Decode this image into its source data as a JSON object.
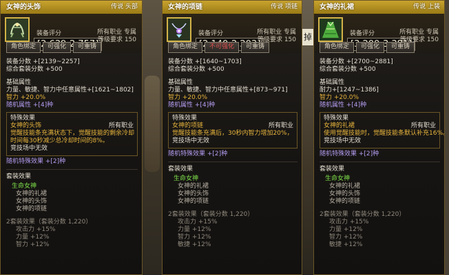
{
  "panels": [
    {
      "title": "女神的头饰",
      "tag": "传说 头部",
      "score_label": "装备评分",
      "score": "[2,639-2,757]",
      "class": "所有职业 专属",
      "level": "等级要求 150",
      "buttons": [
        "角色绑定",
        "可强化",
        "可重铸"
      ],
      "equip_score": "装备分数 +[2139~2257]",
      "set_score": "综合套装分数 +500",
      "base_title": "基础属性",
      "base_lines": [
        "力量、敏捷、智力中任意属性+[1621~1802]"
      ],
      "base_gold": "智力 +20.0%",
      "random_attr": "随机属性 +[4]种",
      "special_title": "特殊效果",
      "special_name": "女神的头饰",
      "special_class": "所有职业",
      "special_desc": [
        "觉醒技能条充满状态下，觉醒技能的剩余冷却",
        "时间每30秒减少总冷却时间的8%。"
      ],
      "special_note": "竞技场中无效",
      "special_random": "随机特殊效果 +[2]种",
      "set_title": "套装效果",
      "set_name": "生命女神",
      "set_items": [
        "女神的礼裙",
        "女神的头饰",
        "女神的项链"
      ],
      "set2_title": "2套装效果（套装分数 1,220）",
      "set2_lines": [
        "攻击力 +15%",
        "力量 +12%",
        "智力 +12%"
      ]
    },
    {
      "title": "女神的项链",
      "tag": "传说 项链",
      "score_label": "装备评分",
      "score": "[2,140-2,203]",
      "class": "所有职业 专属",
      "level": "等级要求 150",
      "buttons": [
        "角色绑定",
        "不可强化",
        "可重铸"
      ],
      "equip_score": "装备分数 +[1640~1703]",
      "set_score": "综合套装分数 +500",
      "base_title": "基础属性",
      "base_lines": [
        "力量、敏捷、智力中任意属性+[873~971]"
      ],
      "base_gold": "智力 +20.0%",
      "random_attr": "随机属性 +[4]种",
      "special_title": "特殊效果",
      "special_name": "女神的项链",
      "special_class": "所有职业",
      "special_desc": [
        "觉醒技能条充满后，30秒内智力增加20%，"
      ],
      "special_note": "竞技场中无效",
      "special_random": "随机特殊效果 +[2]种",
      "set_title": "套装效果",
      "set_name": "生命女神",
      "set_items": [
        "女神的礼裙",
        "女神的头饰",
        "女神的项链"
      ],
      "set2_title": "2套装效果（套装分数 1,220）",
      "set2_lines": [
        "攻击力 +15%",
        "力量 +12%",
        "智力 +12%",
        "敏捷 +12%"
      ]
    },
    {
      "title": "女神的礼裙",
      "tag": "传说 上装",
      "score_label": "装备评分",
      "score": "[3,200-3,381]",
      "class": "所有职业 专属",
      "level": "等级要求 150",
      "buttons": [
        "角色绑定",
        "可强化",
        "可重铸"
      ],
      "equip_score": "装备分数 +[2700~2881]",
      "set_score": "综合套装分数 +500",
      "base_title": "基础属性",
      "base_lines": [
        "耐力+[1247~1386]"
      ],
      "base_gold": "智力 +20.0%",
      "random_attr": "随机属性 +[4]种",
      "special_title": "特殊效果",
      "special_name": "女神的礼裙",
      "special_class": "所有职业",
      "special_desc": [
        "使用觉醒技能时，觉醒技能条默认补充16%。"
      ],
      "special_note": "竞技场中无效",
      "special_random": "随机特殊效果 +[2]种",
      "set_title": "套装效果",
      "set_name": "生命女神",
      "set_items": [
        "女神的礼裙",
        "女神的头饰",
        "女神的项链"
      ],
      "set2_title": "2套装效果（套装分数 1,220）",
      "set2_lines": [
        "攻击力 +15%",
        "力量 +12%",
        "智力 +12%",
        "敏捷 +12%"
      ]
    }
  ],
  "background": {
    "sign_text": "掉"
  },
  "colors": {
    "title_gold": "#c9a42e",
    "gold_text": "#e6b43c",
    "purple_text": "#b39cf0",
    "green_text": "#7fe04a",
    "warn_red": "#e05050"
  },
  "icons": [
    "headdress-icon",
    "necklace-icon",
    "dress-icon"
  ]
}
